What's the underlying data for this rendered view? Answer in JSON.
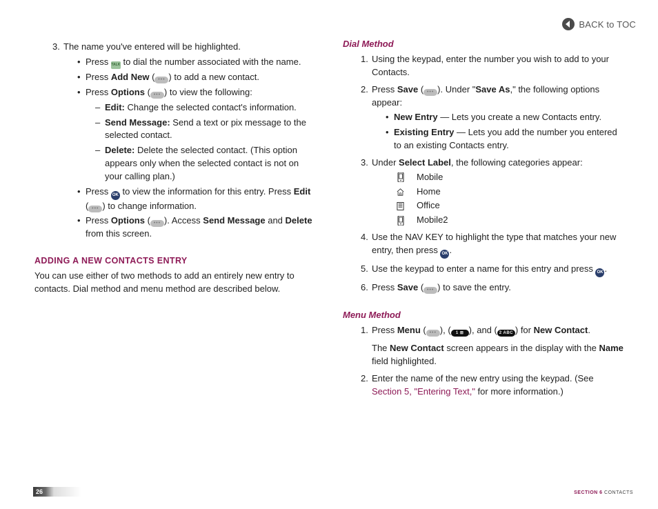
{
  "header": {
    "back": "BACK to TOC"
  },
  "left": {
    "step3": {
      "num": "3.",
      "text": "The name you've entered will be highlighted."
    },
    "b1_a": "Press ",
    "b1_b": " to dial the number associated with the name.",
    "b2_a": "Press ",
    "b2_bold": "Add New",
    "b2_b": " (",
    "b2_paren_close": ")",
    "b2_c": "  to add a new contact.",
    "b3_a": "Press ",
    "b3_bold": "Options",
    "b3_b": " (",
    "b3_paren_close": ")",
    "b3_c": "  to view the following:",
    "d1_bold": "Edit:",
    "d1_text": " Change the selected contact's information.",
    "d2_bold": "Send Message:",
    "d2_text": " Send a text or pix message to the selected contact.",
    "d3_bold": "Delete:",
    "d3_text": " Delete the selected contact. (This option appears only when the selected contact is not on your calling plan.)",
    "b4_a": "Press ",
    "b4_b": "  to view the information for this entry. Press ",
    "b4_bold": "Edit",
    "b4_c": " (",
    "b4_paren_close": ")",
    "b4_d": "  to change information.",
    "b5_a": "Press ",
    "b5_bold1": "Options",
    "b5_b": " (",
    "b5_paren_close": ")",
    "b5_c": ".  Access ",
    "b5_bold2": "Send Message",
    "b5_d": " and ",
    "b5_bold3": "Delete",
    "b5_e": " from this screen.",
    "heading": "ADDING A NEW CONTACTS ENTRY",
    "body": "You can use either of two methods to add an entirely new entry to contacts. Dial method and menu method are described below."
  },
  "right": {
    "dial_heading": "Dial Method",
    "d_step1": {
      "num": "1.",
      "a": "Using the keypad, enter the number you wish to add to your Contacts."
    },
    "d_step2": {
      "num": "2.",
      "a": "Press ",
      "bold1": "Save",
      "b": " (",
      "paren_close": ")",
      "c": ". Under \"",
      "bold2": "Save As",
      "d": ",\" the following options appear:"
    },
    "d_b1_bold": "New Entry",
    "d_b1_txt": " — Lets you create a new Contacts entry.",
    "d_b2_bold": "Existing Entry",
    "d_b2_txt": " — Lets you add the number you entered to an existing Contacts entry.",
    "d_step3": {
      "num": "3.",
      "a": "Under ",
      "bold": "Select Label",
      "b": ", the following categories appear:"
    },
    "labels": {
      "mobile": "Mobile",
      "home": "Home",
      "office": "Office",
      "mobile2": "Mobile2"
    },
    "d_step4": {
      "num": "4.",
      "a": "Use the NAV KEY to highlight the type that matches your new entry, then press ",
      "b": "."
    },
    "d_step5": {
      "num": "5.",
      "a": "Use the keypad to enter a name for this entry and press ",
      "b": "."
    },
    "d_step6": {
      "num": "6.",
      "a": "Press ",
      "bold": "Save",
      "b": " (",
      "paren_close": ")",
      "c": "  to save the entry."
    },
    "menu_heading": "Menu Method",
    "m_step1": {
      "num": "1.",
      "a": "Press ",
      "bold1": "Menu",
      "b": " (",
      "paren1_close": ")",
      "c": ", (",
      "paren2_close": ")",
      "d": ", and (",
      "paren3_close": ")",
      "e": " for ",
      "bold2": "New Contact",
      "f": "."
    },
    "m_step1_note_a": "The ",
    "m_step1_note_bold1": "New Contact",
    "m_step1_note_b": " screen appears in the display with the ",
    "m_step1_note_bold2": "Name",
    "m_step1_note_c": " field highlighted.",
    "m_step2": {
      "num": "2.",
      "a": "Enter the name of the new entry using the keypad. (See ",
      "link1": "Section 5,",
      "link2": "\"Entering Text,\"",
      "b": " for more information.)"
    }
  },
  "footer": {
    "page": "26",
    "section_a": "SECTION 6",
    "section_b": " CONTACTS"
  }
}
